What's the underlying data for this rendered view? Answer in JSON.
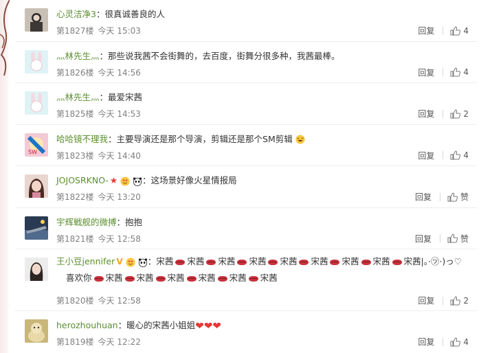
{
  "comments": [
    {
      "user": "心灵洁净3",
      "content": "很真诚善良的人",
      "floor": "第1827楼",
      "time": "今天 15:03",
      "reply": "回复",
      "likes": "4"
    },
    {
      "user": "灬林先生灬",
      "content": "那些说我茜不会街舞的，去百度，街舞分很多种，我茜最棒。",
      "floor": "第1826楼",
      "time": "今天 14:56",
      "reply": "回复",
      "likes": "4"
    },
    {
      "user": "灬林先生灬",
      "content": "最爱宋茜",
      "floor": "第1825楼",
      "time": "今天 14:53",
      "reply": "回复",
      "likes": "2"
    },
    {
      "user": "哈哈镜不理我",
      "content": "主要导演还是那个导演，剪辑还是那个SM剪辑",
      "floor": "第1823楼",
      "time": "今天 14:40",
      "reply": "回复",
      "likes": "4"
    },
    {
      "user": "JOJOSRKNO-",
      "content": "这场景好像火星情报局",
      "floor": "第1822楼",
      "time": "今天 13:20",
      "reply": "回复",
      "likes": "赞"
    },
    {
      "user": "宇辉戦舰的微搏",
      "content": "抱抱",
      "floor": "第1821楼",
      "time": "今天 12:58",
      "reply": "回复",
      "likes": "赞"
    },
    {
      "user": "王小豆jennifer",
      "content_a": "宋茜",
      "content_b": "宋茜|。·㋡·)っ♡",
      "content_c": "喜欢你",
      "content_d": "宋茜",
      "floor": "第1820楼",
      "time": "今天 12:58",
      "reply": "回复",
      "likes": "2"
    },
    {
      "user": "herozhouhuan",
      "content": "暖心的宋茜小姐姐",
      "floor": "第1819楼",
      "time": "今天 12:22",
      "reply": "回复",
      "likes": "4"
    }
  ],
  "colors": {
    "username": "#5b8f2f",
    "meta": "#808080",
    "accent_red": "#c8323c"
  },
  "icons": {
    "like": "thumbs-up-icon"
  }
}
